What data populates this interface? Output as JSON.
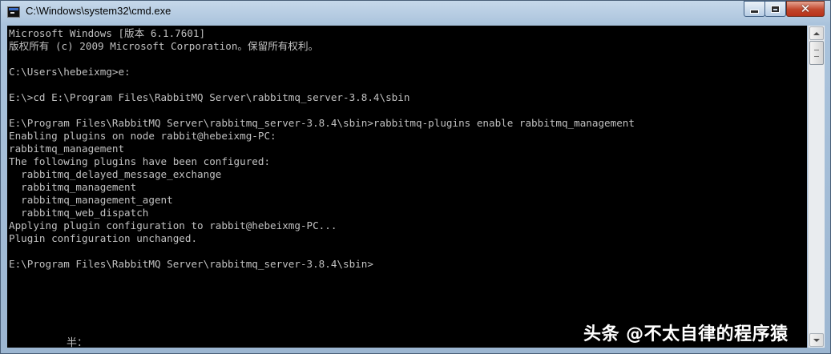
{
  "window": {
    "title": "C:\\Windows\\system32\\cmd.exe",
    "icon": "cmd-console-icon",
    "controls": {
      "minimize_icon": "minimize-icon",
      "maximize_icon": "maximize-icon",
      "close_glyph": "✕"
    }
  },
  "console": {
    "background": "#000000",
    "foreground": "#c0c0c0",
    "lines": [
      "Microsoft Windows [版本 6.1.7601]",
      "版权所有 (c) 2009 Microsoft Corporation。保留所有权利。",
      "",
      "C:\\Users\\hebeixmg>e:",
      "",
      "E:\\>cd E:\\Program Files\\RabbitMQ Server\\rabbitmq_server-3.8.4\\sbin",
      "",
      "E:\\Program Files\\RabbitMQ Server\\rabbitmq_server-3.8.4\\sbin>rabbitmq-plugins enable rabbitmq_management",
      "Enabling plugins on node rabbit@hebeixmg-PC:",
      "rabbitmq_management",
      "The following plugins have been configured:",
      "  rabbitmq_delayed_message_exchange",
      "  rabbitmq_management",
      "  rabbitmq_management_agent",
      "  rabbitmq_web_dispatch",
      "Applying plugin configuration to rabbit@hebeixmg-PC...",
      "Plugin configuration unchanged.",
      "",
      "E:\\Program Files\\RabbitMQ Server\\rabbitmq_server-3.8.4\\sbin>"
    ],
    "ime_status": "半："
  },
  "watermark": "头条 @不太自律的程序猿"
}
